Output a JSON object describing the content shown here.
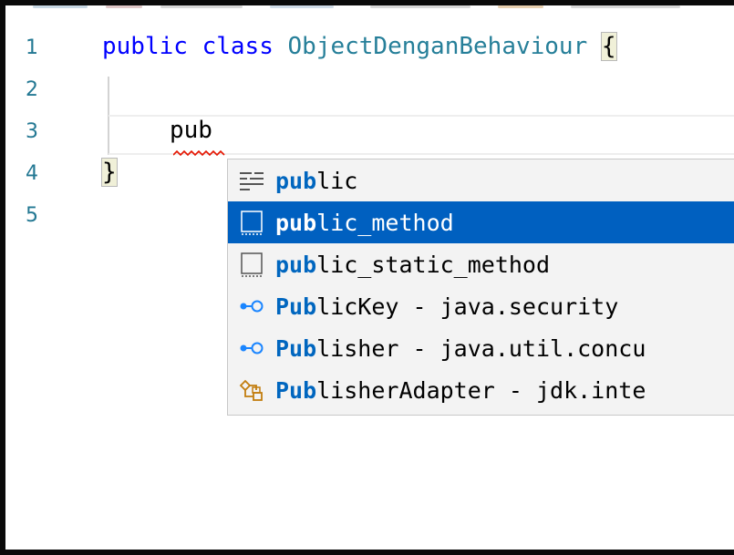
{
  "editor": {
    "lines": [
      {
        "number": "1",
        "keyword1": "public",
        "keyword2": "class",
        "class_name": "ObjectDenganBehaviour",
        "brace": "{"
      },
      {
        "number": "2"
      },
      {
        "number": "3",
        "text": "pub"
      },
      {
        "number": "4",
        "brace": "}"
      },
      {
        "number": "5"
      }
    ]
  },
  "suggestions": {
    "items": [
      {
        "match": "pub",
        "rest": "lic",
        "icon": "keyword-icon"
      },
      {
        "match": "pub",
        "rest": "lic_method",
        "icon": "snippet-icon",
        "selected": true
      },
      {
        "match": "pub",
        "rest": "lic_static_method",
        "icon": "snippet-icon"
      },
      {
        "match": "Pub",
        "rest": "licKey - java.security",
        "icon": "interface-icon"
      },
      {
        "match": "Pub",
        "rest": "lisher - java.util.concu",
        "icon": "interface-icon"
      },
      {
        "match": "Pub",
        "rest": "lisherAdapter - jdk.inte",
        "icon": "class-icon"
      }
    ]
  },
  "colors": {
    "line_number": "#237893",
    "keyword": "#0000ff",
    "type_name": "#267f99",
    "selection": "#0060c0",
    "match_highlight": "#0066bf",
    "error_squiggle": "#e51400",
    "class_icon": "#c27d0e",
    "interface_icon": "#1a85ff"
  }
}
